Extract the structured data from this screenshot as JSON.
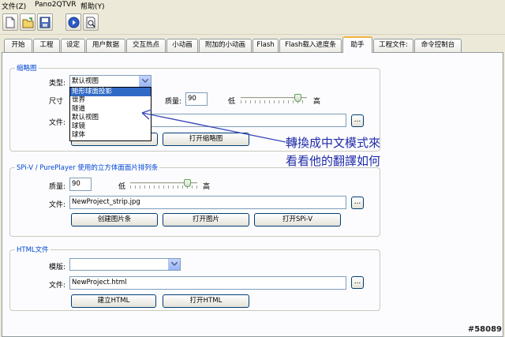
{
  "menubar": {
    "items": [
      "文件(Z)",
      "Pano2QTVR",
      "帮助(Y)"
    ]
  },
  "toolbar": {
    "icons": [
      "new-file-icon",
      "open-folder-icon",
      "save-icon",
      "run-icon",
      "preview-icon"
    ]
  },
  "tabs": [
    {
      "label": "开始",
      "active": false
    },
    {
      "label": "工程",
      "active": false
    },
    {
      "label": "设定",
      "active": false
    },
    {
      "label": "用户数据",
      "active": false
    },
    {
      "label": "交互热点",
      "active": false
    },
    {
      "label": "小动画",
      "active": false
    },
    {
      "label": "附加的小动画",
      "active": false
    },
    {
      "label": "Flash",
      "active": false
    },
    {
      "label": "Flash载入进度条",
      "active": false
    },
    {
      "label": "助手",
      "active": true
    },
    {
      "label": "工程文件:",
      "active": false
    },
    {
      "label": "命令控制台",
      "active": false
    }
  ],
  "thumbnail": {
    "legend": "缩略图",
    "type_label": "类型:",
    "type_value": "默认视图",
    "size_label": "尺寸",
    "quality_label": "质量:",
    "quality_value": "90",
    "low_label": "低",
    "high_label": "高",
    "file_label": "文件:",
    "file_value": "",
    "browse_label": "...",
    "create_button": "创建缩略图",
    "open_button": "打开缩略图",
    "quality_level": 0.9,
    "dropdown_options": [
      "矩形球面投影",
      "世界",
      "隧道",
      "默认视图",
      "球镜",
      "球体"
    ],
    "dropdown_selected_index": 0
  },
  "spiv": {
    "legend": "SPi-V / PurePlayer 使用的立方体面面片排列条",
    "quality_label": "质量:",
    "quality_value": "90",
    "low_label": "低",
    "high_label": "高",
    "file_label": "文件:",
    "file_value": "NewProject_strip.jpg",
    "browse_label": "...",
    "create_button": "创建图片条",
    "open_image_button": "打开图片",
    "open_spiv_button": "打开SPi-V",
    "quality_level": 0.9
  },
  "html": {
    "legend": "HTML文件",
    "template_label": "模版:",
    "template_value": "",
    "file_label": "文件:",
    "file_value": "NewProject.html",
    "browse_label": "...",
    "create_button": "建立HTML",
    "open_button": "打开HTML"
  },
  "annotation": {
    "line1": "轉換成中文模式來",
    "line2": "看看他的翻譯如何"
  },
  "watermark": "#58089",
  "colors": {
    "accent": "#316ac5",
    "annotation": "#1e2aa8",
    "tab_highlight": "#f3b13f"
  }
}
